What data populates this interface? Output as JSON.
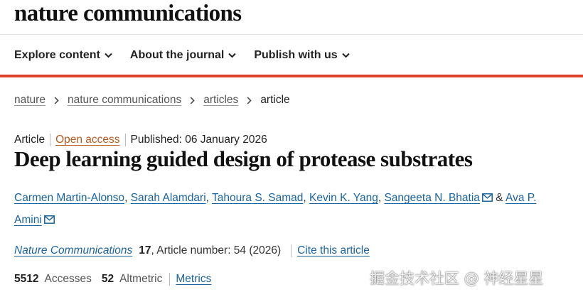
{
  "header": {
    "brand": "nature communications"
  },
  "nav": {
    "items": [
      {
        "label": "Explore content"
      },
      {
        "label": "About the journal"
      },
      {
        "label": "Publish with us"
      }
    ]
  },
  "breadcrumb": {
    "items": [
      "nature",
      "nature communications",
      "articles"
    ],
    "current": "article"
  },
  "article": {
    "type": "Article",
    "access": "Open access",
    "published": "Published: 06 January 2026",
    "title": "Deep learning guided design of protease substrates",
    "authors": [
      "Carmen Martin-Alonso",
      "Sarah Alamdari",
      "Tahoura S. Samad",
      "Kevin K. Yang",
      "Sangeeta N. Bhatia",
      "Ava P. Amini"
    ],
    "author_separator": ",",
    "author_last_joiner": "&",
    "journal": "Nature Communications",
    "volume": "17",
    "article_number": ", Article number: 54 (2026)",
    "cite_label": "Cite this article",
    "accesses_value": "5512",
    "accesses_label": "Accesses",
    "altmetric_value": "52",
    "altmetric_label": "Altmetric",
    "metrics_label": "Metrics"
  },
  "watermark": {
    "text": "掘金技术社区 @ 神经星星"
  },
  "colors": {
    "accent_bar": "#e0412d",
    "link": "#1a64a0",
    "open_access": "#b55a1f"
  },
  "icons": {
    "nav_chevron": "chevron-down-icon",
    "breadcrumb_separator": "chevron-right-icon",
    "author_contact": "mail-icon"
  }
}
